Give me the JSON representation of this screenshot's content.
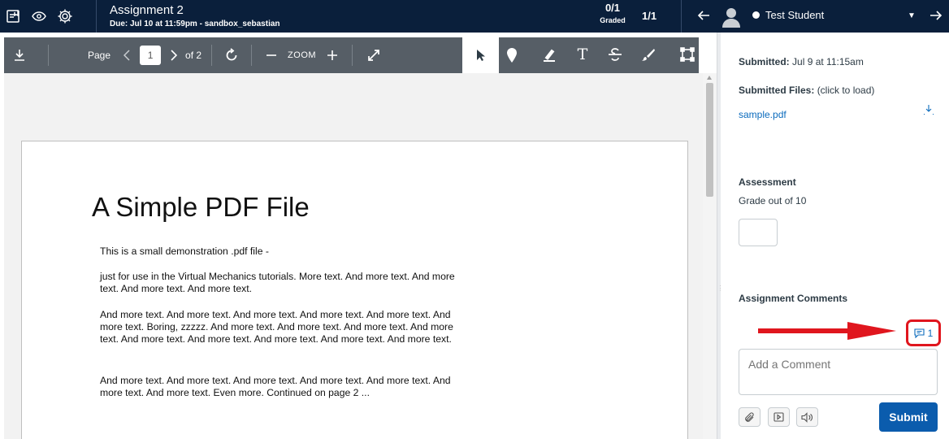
{
  "header": {
    "assignment_title": "Assignment 2",
    "due_line": "Due: Jul 10 at 11:59pm - sandbox_sebastian",
    "graded_count": "0/1",
    "graded_label": "Graded",
    "student_index": "1/1",
    "student_name": "Test Student",
    "icons": [
      "grade-book-icon",
      "eye-icon",
      "gear-icon",
      "arrow-left-icon",
      "avatar-icon",
      "caret-down-icon",
      "arrow-right-icon"
    ]
  },
  "viewer_toolbar": {
    "page_label": "Page",
    "current_page": "1",
    "of_label": "of 2",
    "zoom_label": "ZOOM",
    "tools": [
      "download-icon",
      "prev-page-icon",
      "next-page-icon",
      "rotate-icon",
      "zoom-out-icon",
      "zoom-in-icon",
      "fullscreen-icon",
      "select-pointer-icon",
      "pin-icon",
      "highlight-icon",
      "text-icon",
      "strikeout-icon",
      "draw-icon",
      "area-icon"
    ]
  },
  "document": {
    "title": "A Simple PDF File",
    "paragraphs": [
      "This is a small demonstration .pdf file -",
      "just for use in the Virtual Mechanics tutorials. More text. And more text. And more text. And more text. And more text.",
      "And more text. And more text. And more text. And more text. And more text. And more text. Boring, zzzzz. And more text. And more text. And more text. And more text. And more text. And more text. And more text. And more text. And more text.",
      "And more text. And more text. And more text. And more text. And more text. And more text. And more text. Even more. Continued on page 2 ..."
    ]
  },
  "sidebar": {
    "submitted_label": "Submitted:",
    "submitted_date": "Jul 9 at 11:15am",
    "files_label": "Submitted Files:",
    "files_hint": "(click to load)",
    "file_name": "sample.pdf",
    "assessment_heading": "Assessment",
    "grade_out_of": "Grade out of 10",
    "grade_value": "",
    "comments_heading": "Assignment Comments",
    "comment_count": "1",
    "comment_placeholder": "Add a Comment",
    "submit_label": "Submit"
  },
  "colors": {
    "header_bg": "#0a1f3b",
    "toolbar_bg": "#565e66",
    "link_blue": "#0b6bbd",
    "submit_blue": "#0b5cad",
    "annotation_red": "#e0161e"
  }
}
